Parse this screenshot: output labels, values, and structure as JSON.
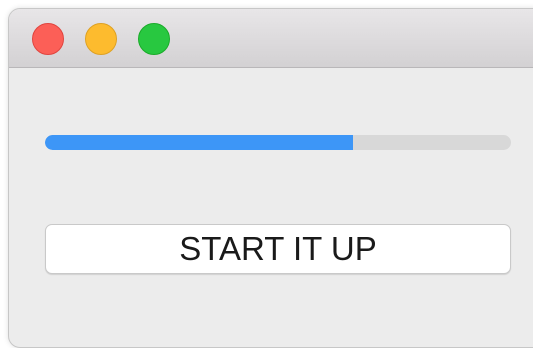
{
  "window": {
    "traffic_lights": [
      {
        "name": "close",
        "color": "#fc5f57"
      },
      {
        "name": "minimize",
        "color": "#fdbb2e"
      },
      {
        "name": "zoom",
        "color": "#28c840"
      }
    ]
  },
  "progress": {
    "value": 0.66,
    "fill_color": "#3d96f7",
    "track_color": "#d8d8d8"
  },
  "button": {
    "label": "START IT UP"
  }
}
